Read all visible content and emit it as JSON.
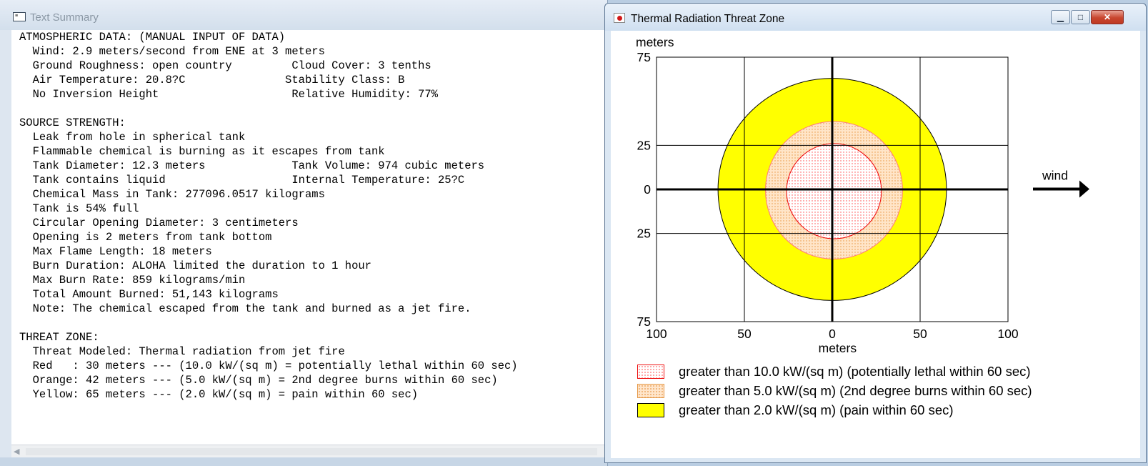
{
  "text_window": {
    "title": "Text Summary",
    "icon": "text-window-icon",
    "lines": [
      "ATMOSPHERIC DATA: (MANUAL INPUT OF DATA)",
      "  Wind: 2.9 meters/second from ENE at 3 meters",
      "  Ground Roughness: open country         Cloud Cover: 3 tenths",
      "  Air Temperature: 20.8?C               Stability Class: B",
      "  No Inversion Height                    Relative Humidity: 77%",
      "",
      "SOURCE STRENGTH:",
      "  Leak from hole in spherical tank",
      "  Flammable chemical is burning as it escapes from tank",
      "  Tank Diameter: 12.3 meters             Tank Volume: 974 cubic meters",
      "  Tank contains liquid                   Internal Temperature: 25?C",
      "  Chemical Mass in Tank: 277096.0517 kilograms",
      "  Tank is 54% full",
      "  Circular Opening Diameter: 3 centimeters",
      "  Opening is 2 meters from tank bottom",
      "  Max Flame Length: 18 meters",
      "  Burn Duration: ALOHA limited the duration to 1 hour",
      "  Max Burn Rate: 859 kilograms/min",
      "  Total Amount Burned: 51,143 kilograms",
      "  Note: The chemical escaped from the tank and burned as a jet fire.",
      "",
      "THREAT ZONE:",
      "  Threat Modeled: Thermal radiation from jet fire",
      "  Red   : 30 meters --- (10.0 kW/(sq m) = potentially lethal within 60 sec)",
      "  Orange: 42 meters --- (5.0 kW/(sq m) = 2nd degree burns within 60 sec)",
      "  Yellow: 65 meters --- (2.0 kW/(sq m) = pain within 60 sec)"
    ]
  },
  "chart_window": {
    "title": "Thermal Radiation Threat Zone",
    "icon": "threat-zone-app-icon",
    "controls": {
      "minimize": "minimize-icon",
      "maximize": "maximize-icon",
      "close": "close-icon"
    }
  },
  "chart_data": {
    "type": "area",
    "title": "",
    "xlabel": "meters",
    "ylabel": "meters",
    "xlim": [
      -100,
      100
    ],
    "ylim": [
      -75,
      75
    ],
    "x_tick_values": [
      -100,
      -50,
      0,
      50,
      100
    ],
    "x_tick_labels": [
      "100",
      "50",
      "0",
      "50",
      "100"
    ],
    "y_tick_values": [
      75,
      25,
      0,
      -25,
      -75
    ],
    "y_tick_labels": [
      "75",
      "25",
      "0",
      "25",
      "75"
    ],
    "grid": true,
    "wind_label": "wind",
    "wind_direction": "right",
    "zones": [
      {
        "name": "greater than 2.0 kW/(sq m) (pain within 60 sec)",
        "color": "#ffff00",
        "pattern": "solid",
        "x_center": 0,
        "y_center": 0,
        "x_radius": 65,
        "y_radius": 63
      },
      {
        "name": "greater than 5.0 kW/(sq m) (2nd degree burns within 60 sec)",
        "color": "#ffd8b0",
        "pattern": "dotted",
        "x_center": 1,
        "y_center": -0.5,
        "x_radius": 39,
        "y_radius": 39
      },
      {
        "name": "greater than 10.0 kW/(sq m) (potentially lethal within 60 sec)",
        "color": "#ff3b3b",
        "pattern": "dotted",
        "x_center": 1,
        "y_center": -1,
        "x_radius": 27,
        "y_radius": 27
      }
    ],
    "legend": [
      {
        "label": "greater than 10.0 kW/(sq m) (potentially lethal within 60 sec)",
        "color": "#ff0000",
        "pattern": "dotted"
      },
      {
        "label": "greater than 5.0 kW/(sq m) (2nd degree burns within 60 sec)",
        "color": "#ffa040",
        "pattern": "dotted"
      },
      {
        "label": "greater than 2.0 kW/(sq m) (pain within 60 sec)",
        "color": "#ffff00",
        "pattern": "solid"
      }
    ],
    "legend_position": "bottom"
  }
}
